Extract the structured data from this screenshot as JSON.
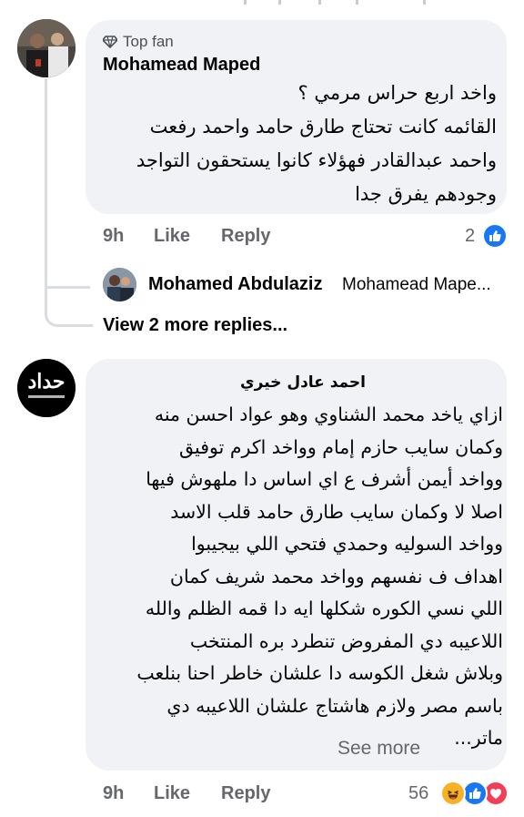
{
  "comment1": {
    "badge": "Top fan",
    "author": "Mohamead Maped",
    "lines": [
      "واخد اربع حراس مرمي ؟",
      "القائمه كانت تحتاج طارق حامد واحمد رفعت",
      "واحمد عبدالقادر فهؤلاء كانوا يستحقون التواجد",
      "وجودهم يفرق جدا"
    ],
    "time": "9h",
    "like_label": "Like",
    "reply_label": "Reply",
    "reaction_count": "2",
    "reaction_icons": [
      "like-icon"
    ]
  },
  "reply_preview": {
    "author": "Mohamed Abdulaziz",
    "text": "Mohamead Mape..."
  },
  "view_more_replies": "View 2 more replies...",
  "comment2": {
    "author": "احمد عادل خيري",
    "avatar_text": "حداد",
    "lines": [
      "ازاي ياخد محمد الشناوي وهو عواد احسن منه",
      "وكمان سايب حازم إمام وواخد اكرم توفيق",
      "وواخد أيمن أشرف ع اي اساس دا ملهوش فيها",
      "اصلا لا وكمان سايب طارق حامد قلب الاسد",
      "وواخد السوليه وحمدي فتحي اللي بيجيبوا",
      "اهداف ف نفسهم وواخد محمد شريف كمان",
      "اللي نسي الكوره شكلها ايه دا قمه الظلم والله",
      "اللاعيبه دي المفروض تنطرد بره المنتخب",
      "وبلاش شغل الكوسه دا علشان خاطر احنا بنلعب",
      "باسم مصر ولازم هاشتاج علشان اللاعيبه دي",
      "ماتر..."
    ],
    "see_more": "See more",
    "time": "9h",
    "like_label": "Like",
    "reply_label": "Reply",
    "reaction_count": "56",
    "reaction_icons": [
      "haha-icon",
      "like-icon",
      "love-icon"
    ]
  },
  "colors": {
    "bubble": "#f0f2f5",
    "secondary_text": "#65676b",
    "like_blue": "#1877f2",
    "love_red": "#f33e58",
    "haha_yellow": "#f7b125"
  }
}
